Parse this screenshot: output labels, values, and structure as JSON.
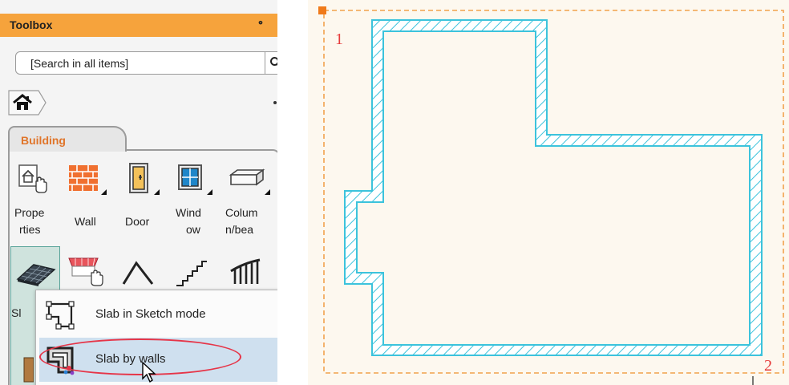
{
  "toolbox": {
    "title": "Toolbox",
    "pin_glyph": "॰",
    "search": {
      "placeholder": "[Search in all items]",
      "icon": "search-icon"
    },
    "breadcrumb": {
      "icon": "home-icon"
    },
    "category_tab": "Building",
    "tools": [
      {
        "label_line1": "Prope",
        "label_line2": "rties",
        "icon": "properties-icon"
      },
      {
        "label_line1": "Wall",
        "label_line2": "",
        "icon": "wall-icon"
      },
      {
        "label_line1": "Door",
        "label_line2": "",
        "icon": "door-icon"
      },
      {
        "label_line1": "Wind",
        "label_line2": "ow",
        "icon": "window-icon"
      },
      {
        "label_line1": "Colum",
        "label_line2": "n/bea",
        "icon": "column-beam-icon"
      }
    ],
    "row2_icons": [
      "slab-icon",
      "roof-light-icon",
      "roof-icon",
      "stair-icon",
      "railing-icon"
    ],
    "slab_partial_label": "Sl",
    "menu": [
      {
        "label": "Slab in Sketch mode",
        "icon": "slab-sketch-icon"
      },
      {
        "label": "Slab by walls",
        "icon": "slab-by-walls-icon",
        "highlighted": true
      }
    ]
  },
  "canvas": {
    "point_labels": [
      "1",
      "2"
    ],
    "colors": {
      "background": "#fdf8ef",
      "wall_outline": "#3cc3dc",
      "selection_rect": "#f2a24d",
      "point_label": "#e63b3b",
      "highlight_ellipse": "#e63548"
    }
  }
}
